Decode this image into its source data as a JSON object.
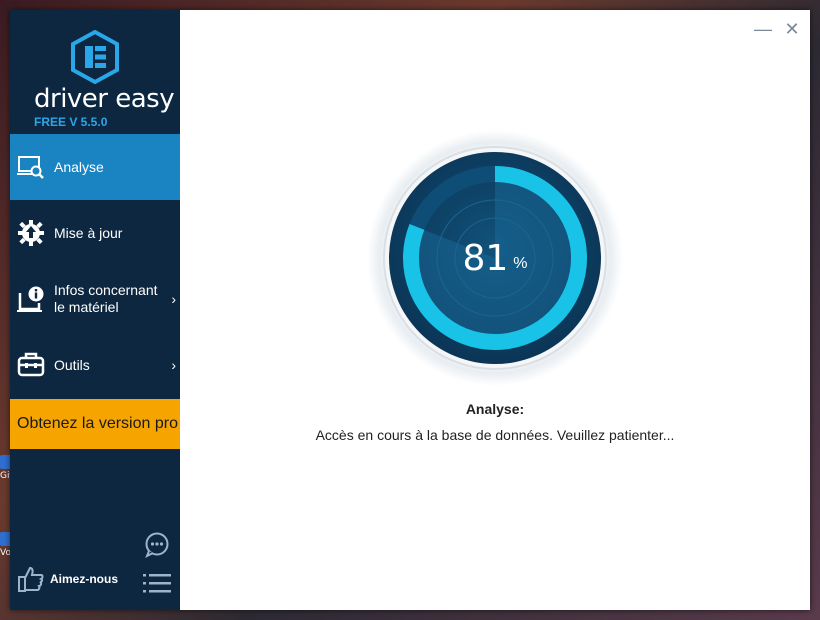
{
  "app": {
    "brand": "driver easy",
    "version": "FREE V 5.5.0"
  },
  "sidebar": {
    "items": [
      {
        "label": "Analyse",
        "icon": "monitor-search-icon",
        "active": true
      },
      {
        "label": "Mise à jour",
        "icon": "gear-update-icon"
      },
      {
        "label": "Infos concernant\nle matériel",
        "icon": "hardware-info-icon",
        "has_submenu": true
      },
      {
        "label": "Outils",
        "icon": "toolbox-icon",
        "has_submenu": true
      }
    ],
    "pro_button": "Obtenez la version pro",
    "like_label": "Aimez-nous"
  },
  "desktop": {
    "icon_labels": [
      "Gif",
      "Vo"
    ]
  },
  "scan": {
    "progress": 81,
    "unit": "%",
    "title": "Analyse:",
    "message": "Accès en cours à la base de données. Veuillez patienter..."
  },
  "colors": {
    "sidebar_bg": "#0d2740",
    "active_bg": "#1a84c2",
    "pro_bg": "#f6a400",
    "gauge_accent": "#19c3e8"
  }
}
